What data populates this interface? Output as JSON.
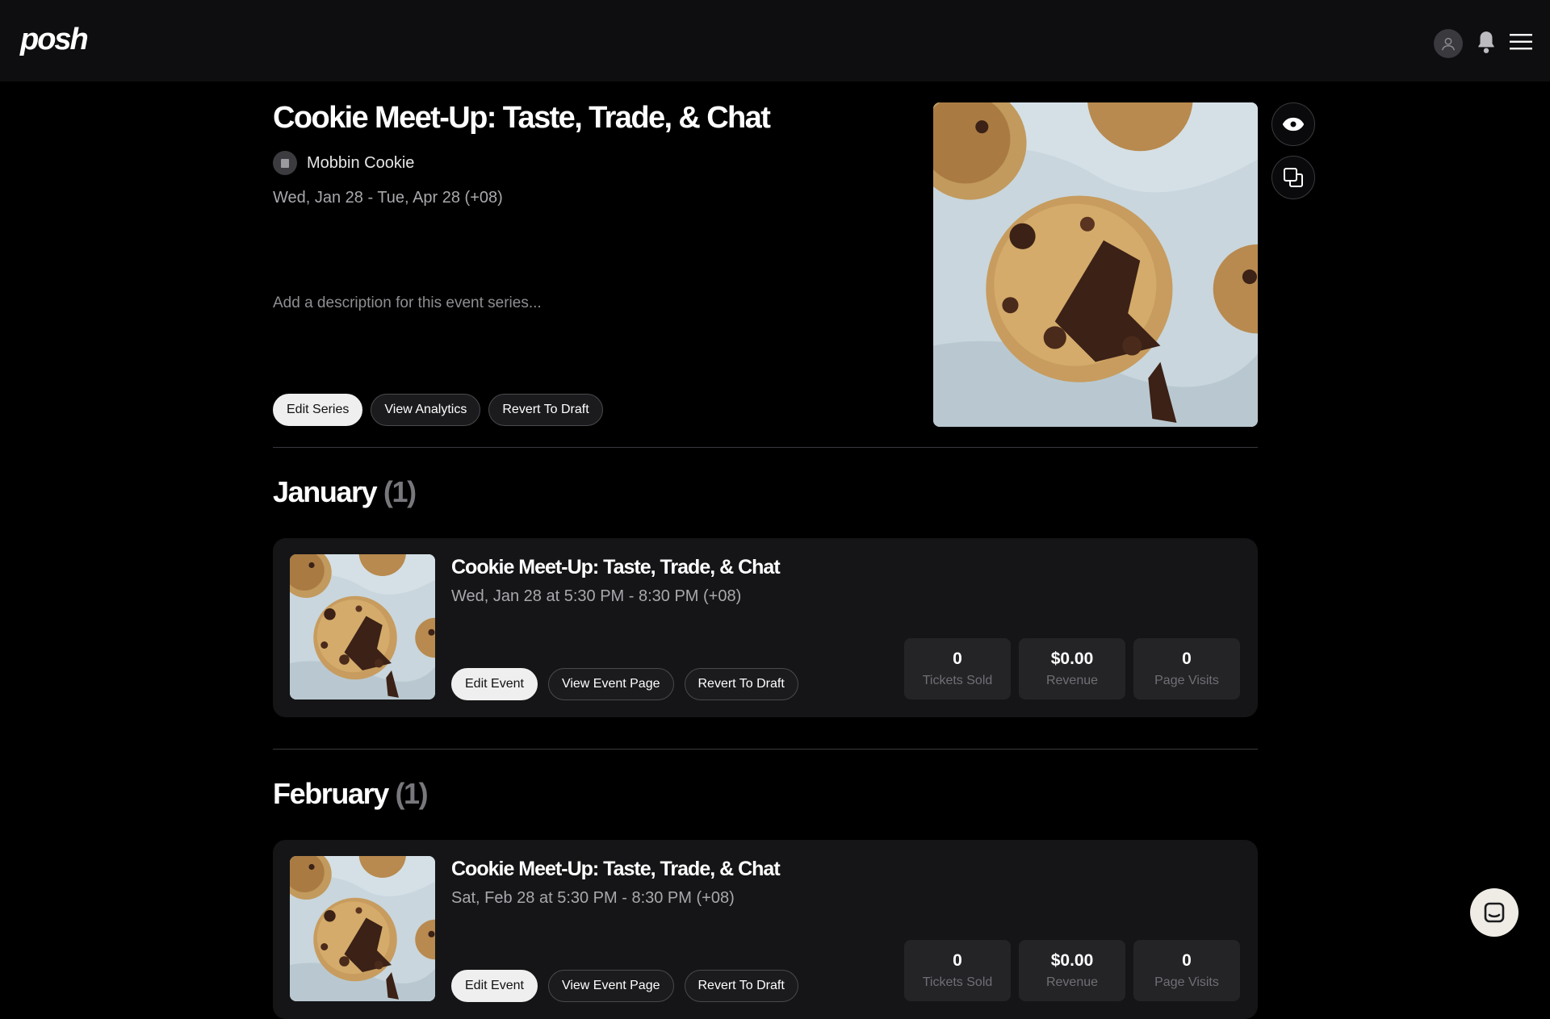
{
  "header": {
    "logo": "posh",
    "icons": [
      "user-avatar-icon",
      "bell-icon",
      "menu-icon"
    ]
  },
  "series": {
    "title": "Cookie Meet-Up: Taste, Trade, & Chat",
    "organizer": "Mobbin Cookie",
    "dates": "Wed, Jan 28 - Tue, Apr 28 (+08)",
    "description_placeholder": "Add a description for this event series...",
    "buttons": {
      "edit": "Edit Series",
      "analytics": "View Analytics",
      "revert": "Revert To Draft"
    },
    "side_icons": [
      "eye-icon",
      "duplicate-icon"
    ]
  },
  "months": [
    {
      "name": "January",
      "count": "(1)",
      "event": {
        "title": "Cookie Meet-Up: Taste, Trade, & Chat",
        "time": "Wed, Jan 28 at 5:30 PM - 8:30 PM (+08)",
        "buttons": {
          "edit": "Edit Event",
          "view": "View Event Page",
          "revert": "Revert To Draft"
        },
        "stats": [
          {
            "value": "0",
            "label": "Tickets Sold"
          },
          {
            "value": "$0.00",
            "label": "Revenue"
          },
          {
            "value": "0",
            "label": "Page Visits"
          }
        ]
      }
    },
    {
      "name": "February",
      "count": "(1)",
      "event": {
        "title": "Cookie Meet-Up: Taste, Trade, & Chat",
        "time": "Sat, Feb 28 at 5:30 PM - 8:30 PM (+08)",
        "buttons": {
          "edit": "Edit Event",
          "view": "View Event Page",
          "revert": "Revert To Draft"
        },
        "stats": [
          {
            "value": "0",
            "label": "Tickets Sold"
          },
          {
            "value": "$0.00",
            "label": "Revenue"
          },
          {
            "value": "0",
            "label": "Page Visits"
          }
        ]
      }
    }
  ],
  "colors": {
    "background": "#000000",
    "header": "#0e0e11",
    "card": "#151517",
    "stat_box": "#242427",
    "muted_text": "#a8a8ad"
  }
}
